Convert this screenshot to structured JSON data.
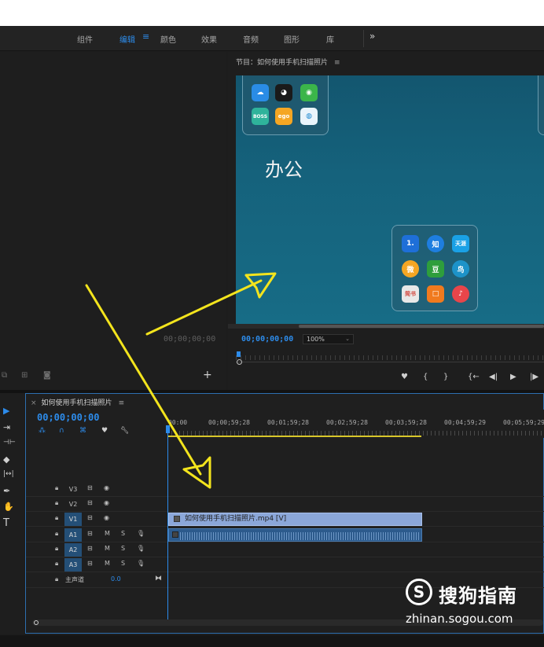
{
  "workspaces": {
    "items": [
      {
        "label": "组件",
        "active": false
      },
      {
        "label": "编辑",
        "active": true
      },
      {
        "label": "颜色",
        "active": false
      },
      {
        "label": "效果",
        "active": false
      },
      {
        "label": "音频",
        "active": false
      },
      {
        "label": "图形",
        "active": false
      },
      {
        "label": "库",
        "active": false
      }
    ],
    "menu_glyph": "≡",
    "more_glyph": "»"
  },
  "source_monitor": {
    "timecode": "00;00;00;00",
    "add_glyph": "+"
  },
  "program_monitor": {
    "title": "节目：如何使用手机扫描照片",
    "menu_glyph": "≡",
    "timecode": "00;00;00;00",
    "zoom": "100%",
    "video": {
      "folder_label": "办公",
      "apps_top": [
        "cloud",
        "qq",
        "wechat",
        "boss",
        "ego",
        "mobile"
      ],
      "apps_bottom": [
        {
          "text": "1.",
          "color": "#1e6fd8"
        },
        {
          "text": "知",
          "color": "#1e7ee0"
        },
        {
          "text": "天涯",
          "color": "#1aa1e6"
        },
        {
          "text": "微",
          "color": "#f5a623"
        },
        {
          "text": "豆",
          "color": "#2e9e3c"
        },
        {
          "text": "鸟",
          "color": "#1d93c9"
        },
        {
          "text": "简书",
          "color": "#e8e8e8"
        },
        {
          "text": "□",
          "color": "#f07a1e"
        },
        {
          "text": "♪",
          "color": "#e8454a"
        }
      ]
    },
    "transport": [
      "♥",
      "{",
      "}",
      "{←",
      "◀|",
      "▶",
      "|▶"
    ]
  },
  "tools": {
    "items": [
      {
        "name": "selection-tool",
        "glyph": "▶"
      },
      {
        "name": "track-select-tool",
        "glyph": "⇥"
      },
      {
        "name": "ripple-edit-tool",
        "glyph": "⊣⊢"
      },
      {
        "name": "razor-tool",
        "glyph": "◆"
      },
      {
        "name": "slip-tool",
        "glyph": "|↔|"
      },
      {
        "name": "pen-tool",
        "glyph": "✒"
      },
      {
        "name": "hand-tool",
        "glyph": "✋"
      },
      {
        "name": "type-tool",
        "glyph": "T"
      }
    ]
  },
  "timeline": {
    "close_glyph": "×",
    "sequence_name": "如何使用手机扫描照片",
    "menu_glyph": "≡",
    "timecode": "00;00;00;00",
    "ruler_labels": [
      "00:00",
      "00;00;59;28",
      "00;01;59;28",
      "00;02;59;28",
      "00;03;59;28",
      "00;04;59;29",
      "00;05;59;29"
    ],
    "video_tracks": [
      {
        "name": "V3",
        "targeted": false
      },
      {
        "name": "V2",
        "targeted": false
      },
      {
        "name": "V1",
        "targeted": true
      }
    ],
    "audio_tracks": [
      {
        "name": "A1",
        "targeted": true
      },
      {
        "name": "A2",
        "targeted": true
      },
      {
        "name": "A3",
        "targeted": true
      }
    ],
    "master": {
      "label": "主声道",
      "value": "0.0"
    },
    "video_clip_label": "如何使用手机扫描照片.mp4 [V]",
    "track_mute": "M",
    "track_solo": "S"
  },
  "watermark": {
    "logo_letter": "S",
    "brand": "搜狗指南",
    "url": "zhinan.sogou.com"
  },
  "colors": {
    "accent": "#2d8ceb",
    "arrow": "#f3e41d",
    "video_clip": "#8ba7d9",
    "audio_clip": "#2c5a8c"
  }
}
